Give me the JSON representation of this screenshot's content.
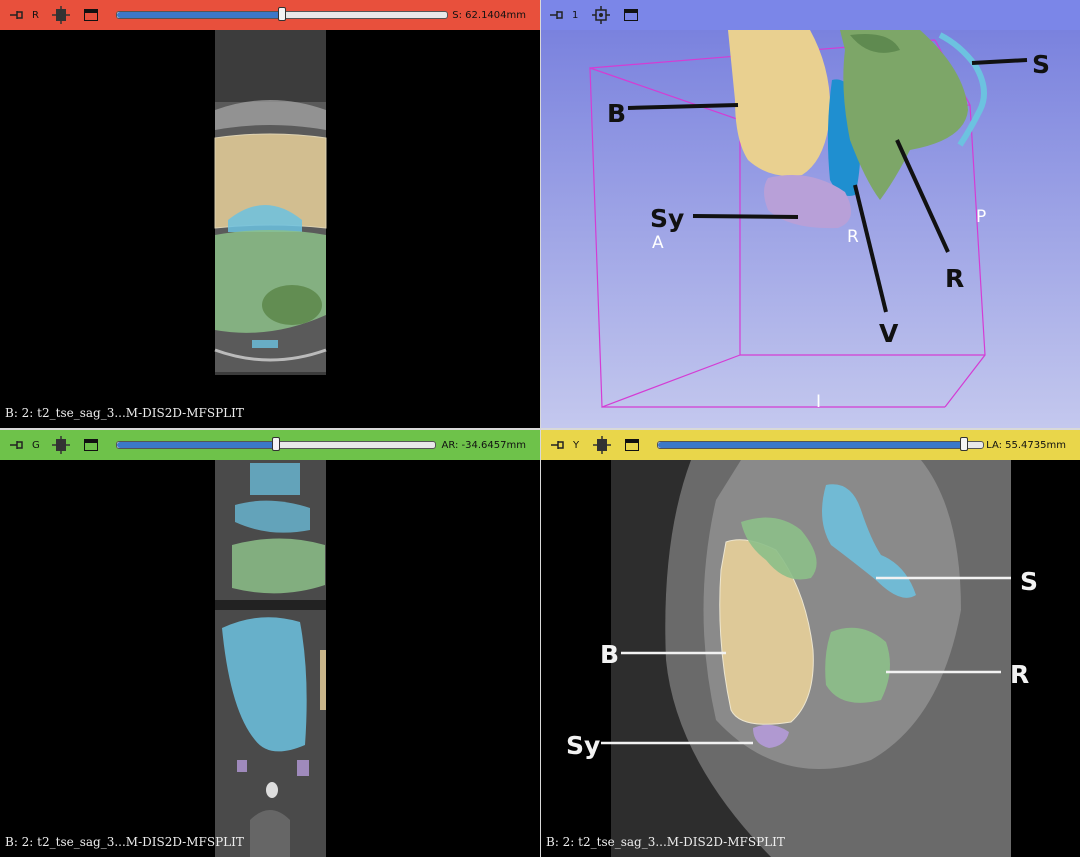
{
  "views": {
    "red": {
      "color": "#e8503c",
      "label": "R",
      "readout": "S: 62.1404mm",
      "slider_fraction": 0.5,
      "corner": "B: 2: t2_tse_sag_3...M-DIS2D-MFSPLIT"
    },
    "threed": {
      "color": "#7b86e8",
      "label": "1",
      "annotations": [
        "B",
        "S",
        "Sy",
        "V",
        "R"
      ],
      "orientation": [
        "A",
        "R",
        "P",
        "I"
      ]
    },
    "green": {
      "color": "#6ec24a",
      "label": "G",
      "readout": "AR: -34.6457mm",
      "slider_fraction": 0.5,
      "corner": "B: 2: t2_tse_sag_3...M-DIS2D-MFSPLIT"
    },
    "yellow": {
      "color": "#e9d64a",
      "label": "Y",
      "readout": "LA: 55.4735mm",
      "slider_fraction": 0.94,
      "corner": "B: 2: t2_tse_sag_3...M-DIS2D-MFSPLIT",
      "annotations": [
        "S",
        "B",
        "R",
        "Sy"
      ]
    }
  },
  "segment_colors": {
    "bladder": "#e8d09a",
    "vagina": "#6cc2e0",
    "rectum": "#8cbf88",
    "symphysis": "#b49ad8"
  }
}
